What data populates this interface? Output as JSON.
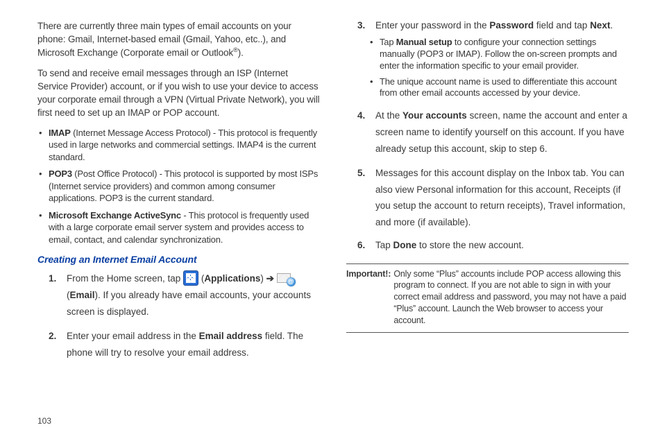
{
  "left": {
    "p1_a": "There are currently three main types of email accounts on your phone: Gmail, Internet-based email (Gmail, Yahoo, etc..), and Microsoft Exchange (Corporate email or Outlook",
    "p1_sup": "®",
    "p1_b": ").",
    "p2": "To send and receive email messages through an ISP (Internet Service Provider) account, or if you wish to use your device to access your corporate email through a VPN (Virtual Private Network), you will first need to set up an IMAP or POP account.",
    "bullets": [
      {
        "bold": "IMAP",
        "rest": " (Internet Message Access Protocol) - This protocol is frequently used in large networks and commercial settings. IMAP4 is the current standard."
      },
      {
        "bold": "POP3",
        "rest": " (Post Office Protocol) - This protocol is supported by most ISPs (Internet service providers) and common among consumer applications. POP3 is the current standard."
      },
      {
        "bold": "Microsoft Exchange ActiveSync",
        "rest": " - This protocol is frequently used with a large corporate email server system and provides access to email, contact, and calendar synchronization."
      }
    ],
    "subhead": "Creating an Internet Email Account",
    "step1": {
      "a": "From the Home screen, tap ",
      "apps_b": "Applications",
      "arrow": " ➔ ",
      "email_pre": " (",
      "email_b": "Email",
      "b": "). If you already have email accounts, your accounts screen is displayed."
    },
    "step2": {
      "a": "Enter your email address in the ",
      "b": "Email address",
      "c": " field. The phone will try to resolve your email address."
    }
  },
  "right": {
    "step3": {
      "a": "Enter your password in the ",
      "b": "Password",
      "c": " field and tap ",
      "d": "Next",
      "e": ".",
      "sub": [
        {
          "pre": "Tap ",
          "bold": "Manual setup",
          "rest": " to configure your connection settings manually (POP3 or IMAP). Follow the on-screen prompts and enter the information specific to your email provider."
        },
        {
          "pre": "",
          "bold": "",
          "rest": "The unique account name is used to differentiate this account from other email accounts accessed by your device."
        }
      ]
    },
    "step4": {
      "a": "At the ",
      "b": "Your accounts",
      "c": " screen, name the account and enter a screen name to identify yourself on this account. If you have already setup this account, skip to step 6."
    },
    "step5": "Messages for this account display on the Inbox tab. You can also view Personal information for this account, Receipts (if you setup the account to return receipts), Travel information, and more (if available).",
    "step6": {
      "a": "Tap ",
      "b": "Done",
      "c": " to store the new account."
    },
    "important_label": "Important!:",
    "important_body": "Only some “Plus” accounts include POP access allowing this program to connect. If you are not able to sign in with your correct email address and password, you may not have a paid “Plus” account. Launch the Web browser to access your account."
  },
  "page_number": "103"
}
